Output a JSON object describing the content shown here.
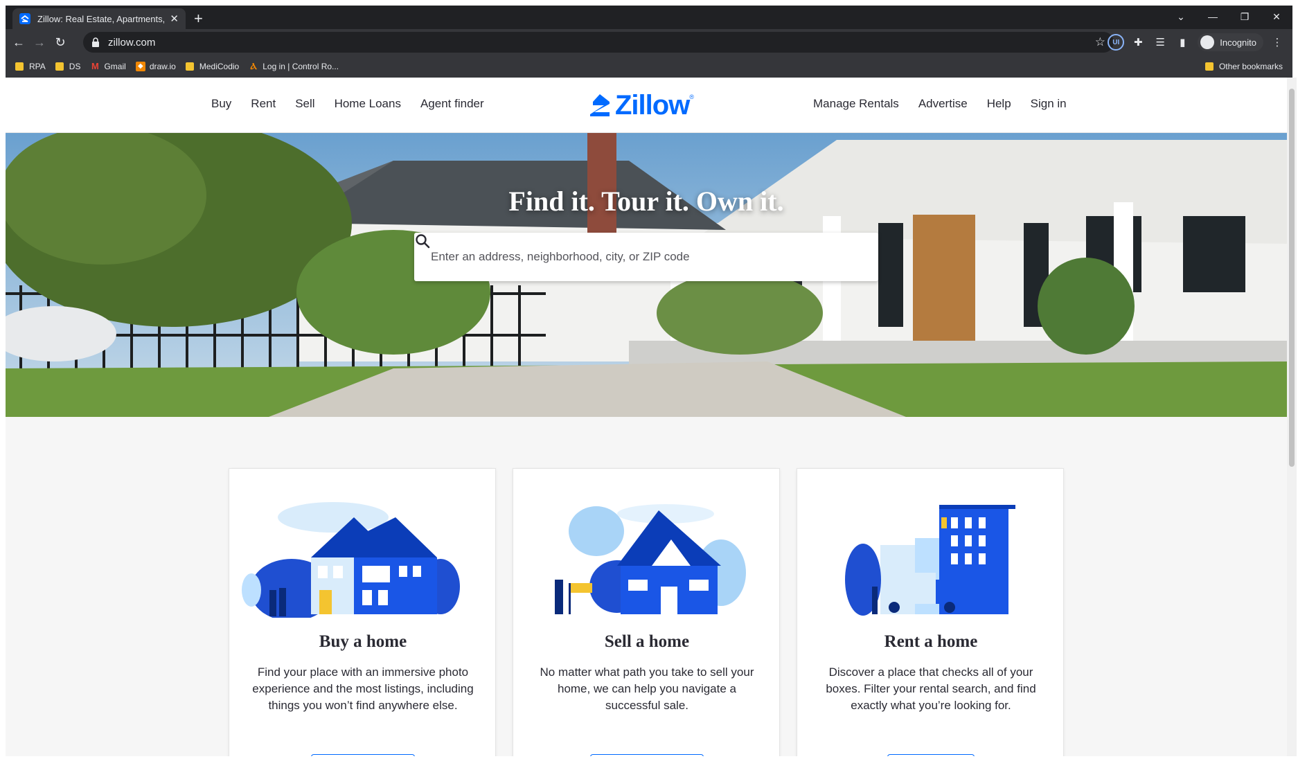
{
  "browser": {
    "tab_title": "Zillow: Real Estate, Apartments, M",
    "url": "zillow.com",
    "profile_label": "Incognito",
    "ext_label": "UI",
    "bookmarks": [
      {
        "label": "RPA",
        "icon": "folder-icon"
      },
      {
        "label": "DS",
        "icon": "folder-icon"
      },
      {
        "label": "Gmail",
        "icon": "gmail-icon"
      },
      {
        "label": "draw.io",
        "icon": "drawio-icon"
      },
      {
        "label": "MediCodio",
        "icon": "folder-icon"
      },
      {
        "label": "Log in | Control Ro...",
        "icon": "control-room-icon"
      }
    ],
    "other_bookmarks": "Other bookmarks"
  },
  "header": {
    "nav_left": [
      "Buy",
      "Rent",
      "Sell",
      "Home Loans",
      "Agent finder"
    ],
    "nav_right": [
      "Manage Rentals",
      "Advertise",
      "Help",
      "Sign in"
    ],
    "logo_text": "Zillow",
    "logo_mark": "®"
  },
  "hero": {
    "title": "Find it. Tour it. Own it.",
    "search_placeholder": "Enter an address, neighborhood, city, or ZIP code"
  },
  "cards": [
    {
      "title": "Buy a home",
      "text": "Find your place with an immersive photo experience and the most listings, including things you won’t find anywhere else."
    },
    {
      "title": "Sell a home",
      "text": "No matter what path you take to sell your home, we can help you navigate a successful sale."
    },
    {
      "title": "Rent a home",
      "text": "Discover a place that checks all of your boxes. Filter your rental search, and find exactly what you’re looking for."
    }
  ],
  "colors": {
    "brand": "#006aff",
    "chrome_bg": "#202124",
    "text": "#2a2a33"
  }
}
